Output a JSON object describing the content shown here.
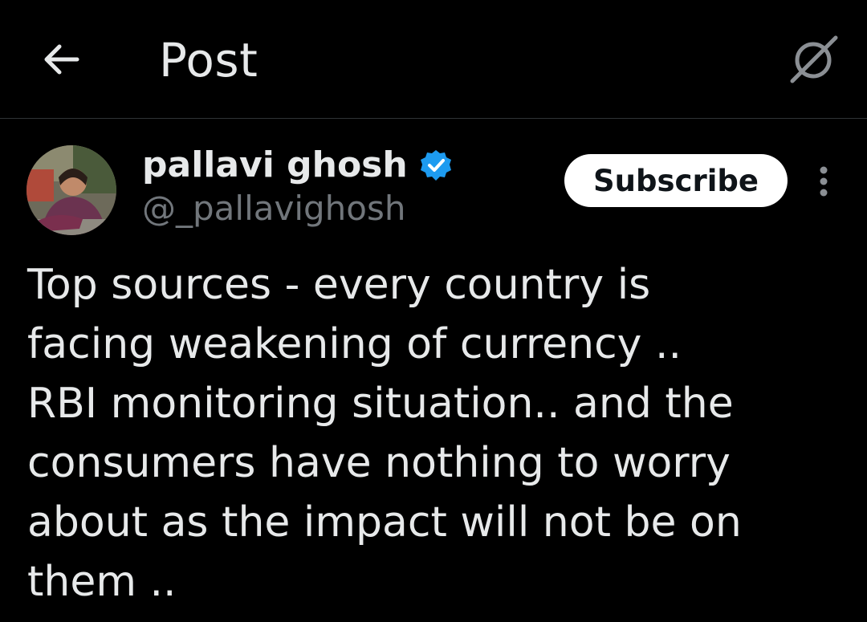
{
  "header": {
    "title": "Post",
    "back_icon": "arrow-left-icon",
    "grok_icon": "grok-icon"
  },
  "author": {
    "name": "pallavi ghosh",
    "handle": "@_pallavighosh",
    "verified": true,
    "verified_color": "#1d9bf0"
  },
  "actions": {
    "subscribe_label": "Subscribe",
    "more_icon": "more-vertical-icon"
  },
  "post": {
    "lines": [
      "Top sources - every country is",
      "facing weakening of currency ..",
      "RBI monitoring situation.. and the",
      "consumers have nothing to worry",
      "about as the impact will not be on",
      "them .."
    ]
  },
  "theme": {
    "background": "#000000",
    "text": "#e7e9ea",
    "secondary_text": "#71767b",
    "divider": "#2f3336"
  }
}
